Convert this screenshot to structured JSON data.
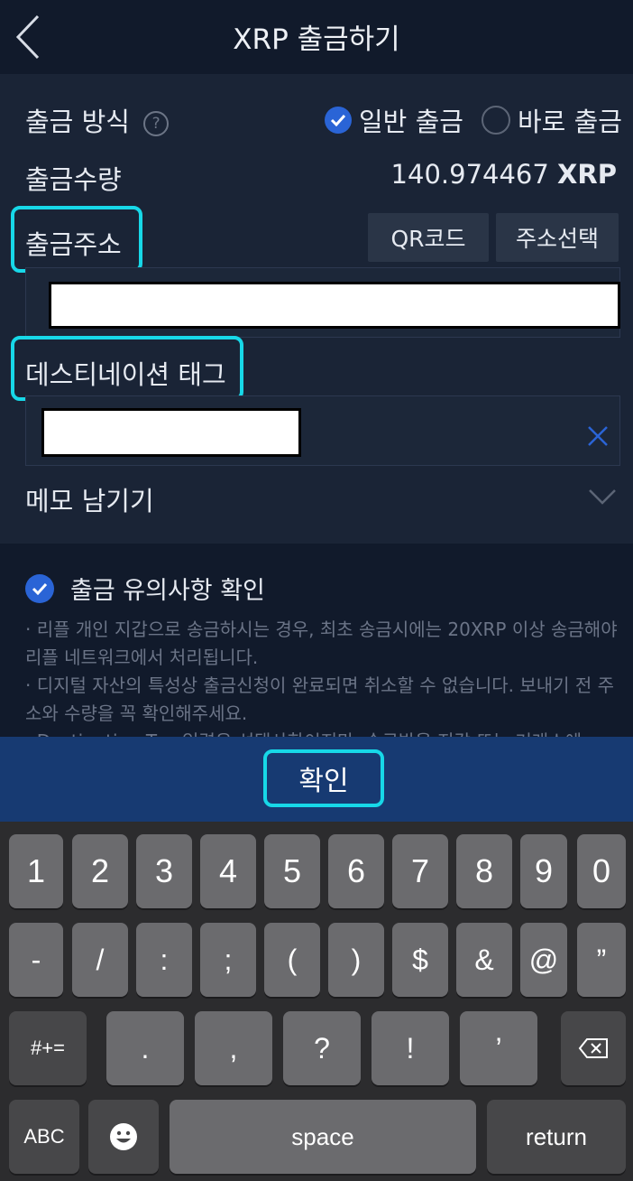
{
  "header": {
    "title": "XRP 출금하기"
  },
  "form": {
    "method_label": "출금 방식",
    "help_symbol": "?",
    "option_general": "일반 출금",
    "option_instant": "바로 출금",
    "amount_label": "출금수량",
    "amount_value": "140.974467",
    "amount_unit": "XRP",
    "address_label": "출금주소",
    "qr_button": "QR코드",
    "select_address_button": "주소선택",
    "tag_label": "데스티네이션 태그",
    "memo_label": "메모 남기기"
  },
  "notice": {
    "title": "출금 유의사항 확인",
    "lines": [
      "· 리플 개인 지갑으로 송금하시는 경우, 최초 송금시에는 20XRP 이상 송금해야 리플 네트워크에서 처리됩니다.",
      "· 디지털 자산의 특성상 출금신청이 완료되면 취소할 수 없습니다. 보내기 전 주소와 수량을 꼭 확인해주세요.",
      "· Destination Tag 입력은 선택사항이지만, 송금받을 지갑 또는 거래소에"
    ]
  },
  "confirm_label": "확인",
  "keyboard": {
    "row1": [
      "1",
      "2",
      "3",
      "4",
      "5",
      "6",
      "7",
      "8",
      "9",
      "0"
    ],
    "row2": [
      "-",
      "/",
      ":",
      ";",
      "(",
      ")",
      "$",
      "&",
      "@",
      "”"
    ],
    "row3": {
      "shift": "#+=",
      "keys": [
        ".",
        ",",
        "?",
        "!",
        "’"
      ]
    },
    "abc": "ABC",
    "space": "space",
    "return": "return"
  },
  "colors": {
    "accent_blue": "#2a64d6",
    "highlight_cyan": "#17d8e8",
    "confirm_bar": "#173a72",
    "panel_bg": "#1a2436",
    "page_bg": "#111a2b"
  },
  "icons": {
    "back": "chevron-left-icon",
    "help": "question-circle-icon",
    "check": "check-circle-icon",
    "clear": "close-icon",
    "expand": "chevron-down-icon",
    "delete": "backspace-icon",
    "emoji": "emoji-icon"
  }
}
